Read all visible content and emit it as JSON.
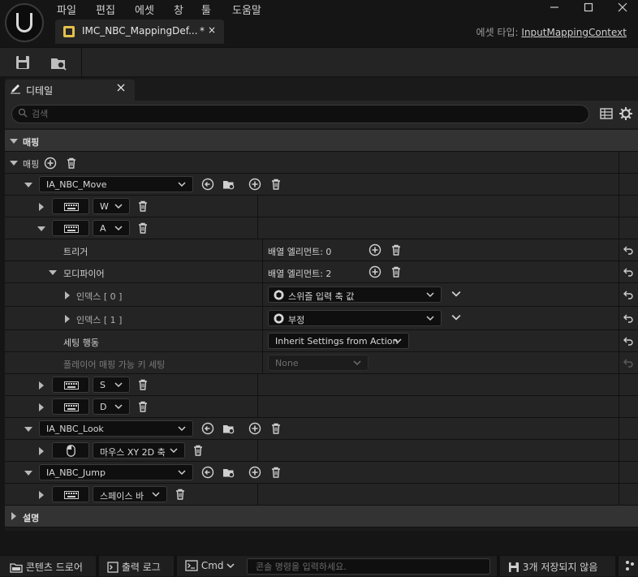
{
  "menu": [
    "파일",
    "편집",
    "에셋",
    "창",
    "툴",
    "도움말"
  ],
  "tab": {
    "label": "IMC_NBC_MappingDef...",
    "dirty": "*",
    "close": "×"
  },
  "asset_type": {
    "label": "에셋 타입:",
    "value": "InputMappingContext"
  },
  "details": {
    "tab_label": "디테일",
    "search_placeholder": "검색",
    "category_mapping": "매핑",
    "mappings_label": "매핑",
    "category_description": "설명",
    "actions": [
      {
        "name": "IA_NBC_Move"
      },
      {
        "name": "IA_NBC_Look"
      },
      {
        "name": "IA_NBC_Jump"
      }
    ],
    "keys": {
      "w": "W",
      "a": "A",
      "s": "S",
      "d": "D",
      "mouse": "마우스 XY 2D 축",
      "space": "스페이스 바"
    },
    "triggers_label": "트리거",
    "triggers_value": "배열 엘리먼트: 0",
    "modifiers_label": "모디파이어",
    "modifiers_value": "배열 엘리먼트: 2",
    "index0_label": "인덱스 [ 0 ]",
    "index0_value": "스위즐 입력 축 값",
    "index1_label": "인덱스 [ 1 ]",
    "index1_value": "부정",
    "settings_behavior_label": "세팅 행동",
    "settings_behavior_value": "Inherit Settings from Action",
    "player_settings_label": "플레이어 매핑 가능 키 세팅",
    "player_settings_value": "None"
  },
  "statusbar": {
    "content_drawer": "콘텐츠 드로어",
    "output_log": "출력 로그",
    "cmd": "Cmd",
    "console_placeholder": "콘솔 명령을 입력하세요.",
    "unsaved": "3개 저장되지 않음"
  },
  "colors": {
    "accent_yellow": "#e3c14a",
    "background": "#151515",
    "panel": "#1a1a1a"
  }
}
